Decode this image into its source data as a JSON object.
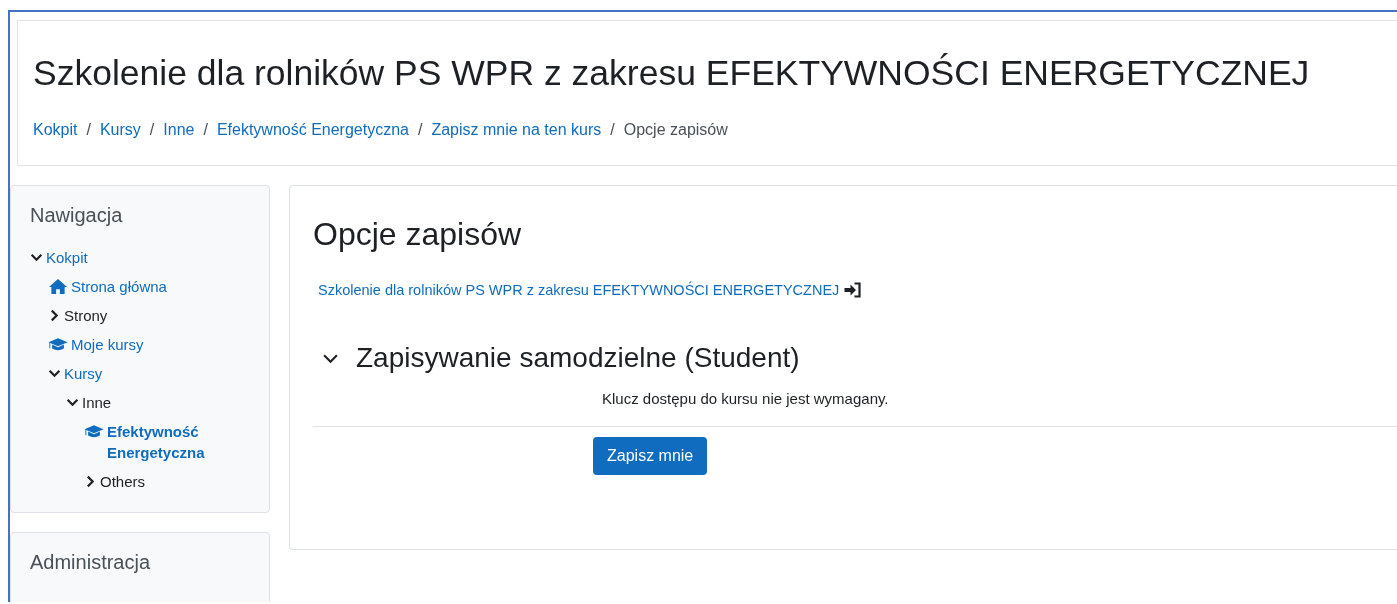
{
  "header": {
    "title": "Szkolenie dla rolników PS WPR z zakresu EFEKTYWNOŚCI ENERGETYCZNEJ",
    "breadcrumb": [
      {
        "label": "Kokpit",
        "link": true
      },
      {
        "label": "Kursy",
        "link": true
      },
      {
        "label": "Inne",
        "link": true
      },
      {
        "label": "Efektywność Energetyczna",
        "link": true
      },
      {
        "label": "Zapisz mnie na ten kurs",
        "link": true
      },
      {
        "label": "Opcje zapisów",
        "link": false
      }
    ],
    "separator": "/"
  },
  "sidebar": {
    "blocks": [
      {
        "title": "Nawigacja",
        "tree": [
          {
            "label": "Kokpit",
            "kind": "branch",
            "expanded": true,
            "link": true,
            "selected": false,
            "children": [
              {
                "label": "Strona główna",
                "kind": "home",
                "link": true,
                "selected": false
              },
              {
                "label": "Strony",
                "kind": "branch",
                "expanded": false,
                "link": false,
                "selected": false
              },
              {
                "label": "Moje kursy",
                "kind": "course",
                "link": true,
                "selected": false
              },
              {
                "label": "Kursy",
                "kind": "branch",
                "expanded": true,
                "link": true,
                "selected": false,
                "children": [
                  {
                    "label": "Inne",
                    "kind": "branch",
                    "expanded": true,
                    "link": false,
                    "selected": false,
                    "children": [
                      {
                        "label": "Efektywność Energetyczna",
                        "kind": "course",
                        "link": true,
                        "selected": true
                      },
                      {
                        "label": "Others",
                        "kind": "branch",
                        "expanded": false,
                        "link": false,
                        "selected": false
                      }
                    ]
                  }
                ]
              }
            ]
          }
        ]
      },
      {
        "title": "Administracja"
      }
    ]
  },
  "main": {
    "heading": "Opcje zapisów",
    "course_link": "Szkolenie dla rolników PS WPR z zakresu EFEKTYWNOŚCI ENERGETYCZNEJ",
    "section": {
      "title": "Zapisywanie samodzielne (Student)",
      "expanded": true,
      "description": "Klucz dostępu do kursu nie jest wymagany.",
      "button": "Zapisz mnie"
    }
  }
}
